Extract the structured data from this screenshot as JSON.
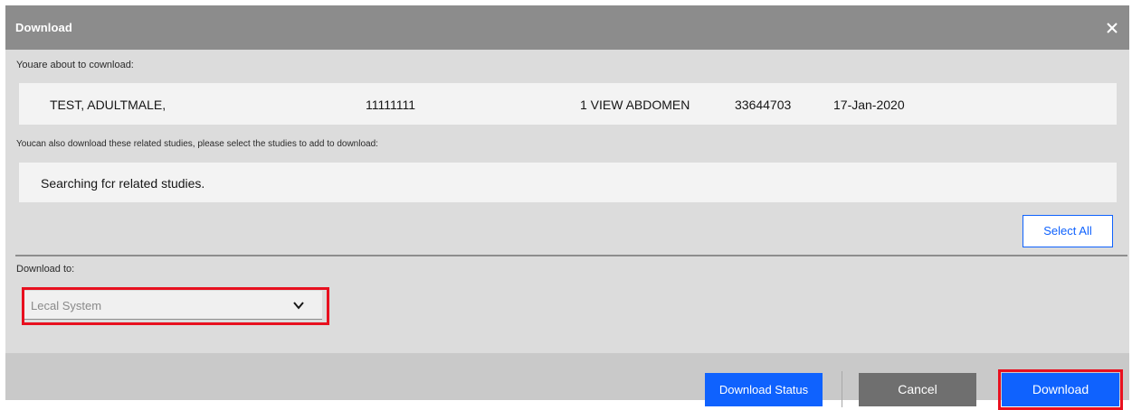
{
  "dialog": {
    "title": "Download",
    "close_icon": "close-icon"
  },
  "download_section": {
    "intro_label": "Youare about to cownload:",
    "study": {
      "patient_name": "TEST, ADULTMALE,",
      "patient_id": "11111111",
      "description": "1 VIEW ABDOMEN",
      "accession": "33644703",
      "date": "17-Jan-2020"
    }
  },
  "related_section": {
    "label": "Youcan also download these related studies, please select the studies to add to download:",
    "status_text": "Searching fcr related studies.",
    "select_all_label": "Select All"
  },
  "destination": {
    "label": "Download to:",
    "selected": "Lecal System",
    "chevron_icon": "chevron-down-icon"
  },
  "footer": {
    "download_status_label": "Download Status",
    "cancel_label": "Cancel",
    "download_label": "Download"
  },
  "colors": {
    "titlebar": "#8c8c8c",
    "primary": "#0f62fe",
    "secondary": "#6f6f6f",
    "highlight": "#e8101f"
  }
}
